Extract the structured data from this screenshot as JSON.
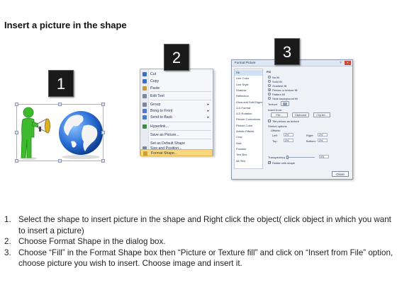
{
  "title": "Insert a picture in the shape",
  "badges": [
    "1",
    "2",
    "3"
  ],
  "context_menu": {
    "items": [
      {
        "label": "Cut",
        "icon": "scissors-icon",
        "color": "#3a6fc8"
      },
      {
        "label": "Copy",
        "icon": "copy-icon",
        "color": "#3a6fc8"
      },
      {
        "label": "Paste",
        "icon": "clipboard-icon",
        "color": "#c89a3a"
      },
      {
        "label": "Edit Text",
        "icon": "edit-text-icon",
        "color": "#7a8699"
      },
      {
        "label": "Group",
        "icon": "group-icon",
        "color": "#7a8699",
        "submenu": true
      },
      {
        "label": "Bring to Front",
        "icon": "bring-front-icon",
        "color": "#4a7ad0",
        "submenu": true
      },
      {
        "label": "Send to Back",
        "icon": "send-back-icon",
        "color": "#4a7ad0",
        "submenu": true
      },
      {
        "label": "Hyperlink...",
        "icon": "hyperlink-icon",
        "color": "#3a8a4a"
      },
      {
        "label": "Save as Picture...",
        "icon": "",
        "color": ""
      },
      {
        "label": "Set as Default Shape",
        "icon": "",
        "color": ""
      },
      {
        "label": "Size and Position...",
        "icon": "size-icon",
        "color": "#7a8699"
      },
      {
        "label": "Format Shape...",
        "icon": "format-shape-icon",
        "color": "#c8a030"
      }
    ],
    "highlight_color": "#f9d77f"
  },
  "dialog": {
    "title": "Format Picture",
    "nav_items": [
      "Fill",
      "Line Color",
      "Line Style",
      "Shadow",
      "Reflection",
      "Glow and Soft Edges",
      "3-D Format",
      "3-D Rotation",
      "Picture Corrections",
      "Picture Color",
      "Artistic Effects",
      "Crop",
      "Size",
      "Position",
      "Text Box",
      "Alt Text"
    ],
    "panel_heading": "Fill",
    "fill_options": [
      "No fill",
      "Solid fill",
      "Gradient fill",
      "Picture or texture fill",
      "Pattern fill",
      "Slide background fill"
    ],
    "texture_label": "Texture:",
    "insert_from_label": "Insert from:",
    "file_button": "File...",
    "clipboard_button": "Clipboard",
    "clipart_button": "Clip Art...",
    "tile_option": "Tile picture as texture",
    "stretch_label": "Stretch options",
    "offsets_label": "Offsets:",
    "left_label": "Left:",
    "left_val": "0%",
    "right_label": "Right:",
    "right_val": "0%",
    "top_label": "Top:",
    "top_val": "0%",
    "bottom_label": "Bottom:",
    "bottom_val": "0%",
    "transparency_label": "Transparency:",
    "transparency_val": "0%",
    "rotate_option": "Rotate with shape",
    "close_button": "Close"
  },
  "steps": [
    {
      "num": "1.",
      "text": "Select the shape to insert picture in the shape and Right click the object( click object in which you want to insert a picture)"
    },
    {
      "num": "2.",
      "text": "Choose Format Shape in the dialog box."
    },
    {
      "num": "3.",
      "text": "Choose “Fill” in the Format Shape box then “Picture or Texture fill”  and click on “Insert from File” option, choose picture you wish to insert. Choose image and insert it."
    }
  ]
}
